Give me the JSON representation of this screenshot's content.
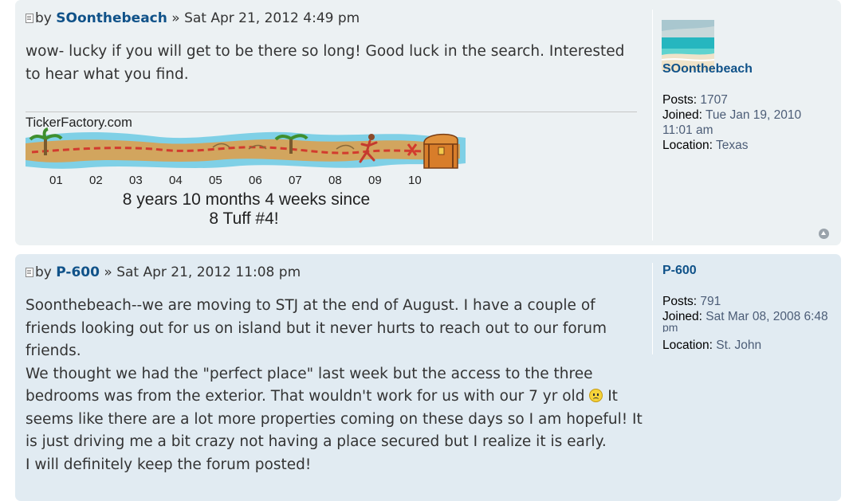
{
  "posts": [
    {
      "by_prefix": "by",
      "author": "SOonthebeach",
      "separator": "»",
      "date": "Sat Apr 21, 2012 4:49 pm",
      "lines": [
        "wow- lucky if you will get to be there so long! Good luck in the search. Interested",
        "to hear what you find."
      ],
      "signature": {
        "brand": "TickerFactory.com",
        "years": [
          "01",
          "02",
          "03",
          "04",
          "05",
          "06",
          "07",
          "08",
          "09",
          "10"
        ],
        "line1": "8 years 10 months 4 weeks since",
        "line2": "8 Tuff #4!"
      },
      "profile": {
        "username": "SOonthebeach",
        "posts_label": "Posts:",
        "posts_value": "1707",
        "joined_label": "Joined:",
        "joined_value_1": "Tue Jan 19, 2010",
        "joined_value_2": "11:01 am",
        "location_label": "Location:",
        "location_value": "Texas"
      }
    },
    {
      "by_prefix": "by",
      "author": "P-600",
      "separator": "»",
      "date": "Sat Apr 21, 2012 11:08 pm",
      "lines": [
        "Soonthebeach--we are moving to STJ at the end of August. I have a couple of",
        "friends looking out for us on island but it never hurts to reach out to our forum",
        "friends.",
        "We thought we had the \"perfect place\" last week but the access to the three",
        "bedrooms was from the exterior. That wouldn't work for us with our 7 yr old",
        "seems like there are a lot more properties coming on these days so I am hopeful! It",
        "is just driving me a bit crazy not having a place secured but I realize it is early.",
        "I will definitely keep the forum posted!"
      ],
      "after_smiley": "It",
      "profile": {
        "username": "P-600",
        "posts_label": "Posts:",
        "posts_value": "791",
        "joined_label": "Joined:",
        "joined_value_1": "Sat Mar 08, 2008 6:48",
        "joined_value_2": "pm",
        "location_label": "Location:",
        "location_value": "St. John"
      }
    }
  ]
}
